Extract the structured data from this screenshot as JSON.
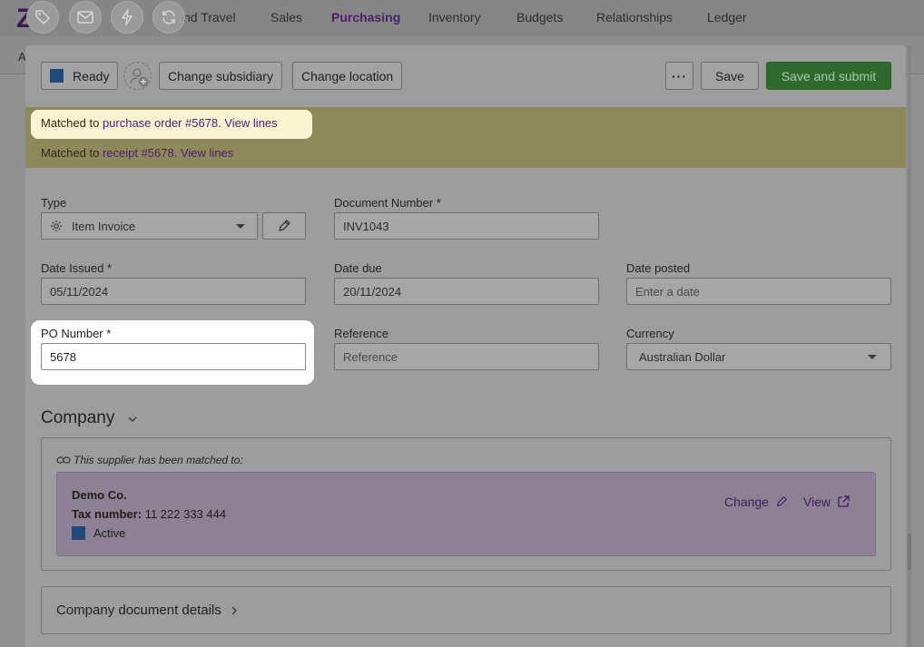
{
  "nav": {
    "logo": "Z",
    "items": [
      "nd Travel",
      "Sales",
      "Purchasing",
      "Inventory",
      "Budgets",
      "Relationships",
      "Ledger"
    ],
    "active": "Purchasing",
    "tool_icons": [
      "tag-icon",
      "mail-icon",
      "lightning-icon",
      "refresh-icon"
    ],
    "sub_letter": "A"
  },
  "toolbar": {
    "status_label": "Ready",
    "status_color": "#1f4a7a",
    "change_subsidiary": "Change subsidiary",
    "change_location": "Change location",
    "more_label": "···",
    "save_label": "Save",
    "save_submit_label": "Save and submit"
  },
  "banner": {
    "line1_prefix": "Matched to ",
    "line1_link": "purchase order #5678. View lines",
    "line2_prefix": "Matched to ",
    "line2_link": "receipt #5678. View lines"
  },
  "form": {
    "type_label": "Type",
    "type_value": "Item Invoice",
    "doc_number_label": "Document Number *",
    "doc_number_value": "INV1043",
    "date_issued_label": "Date Issued *",
    "date_issued_value": "05/11/2024",
    "date_due_label": "Date due",
    "date_due_value": "20/11/2024",
    "date_posted_label": "Date posted",
    "date_posted_placeholder": "Enter a date",
    "po_number_label": "PO Number *",
    "po_number_value": "5678",
    "reference_label": "Reference",
    "reference_placeholder": "Reference",
    "currency_label": "Currency",
    "currency_value": "Australian Dollar"
  },
  "company": {
    "title": "Company",
    "matched_note": "This supplier has been matched to:",
    "name": "Demo Co.",
    "tax_label": "Tax number:",
    "tax_value": "11 222 333 444",
    "status": "Active",
    "change_label": "Change",
    "view_label": "View"
  },
  "details": {
    "title": "Company document details"
  }
}
